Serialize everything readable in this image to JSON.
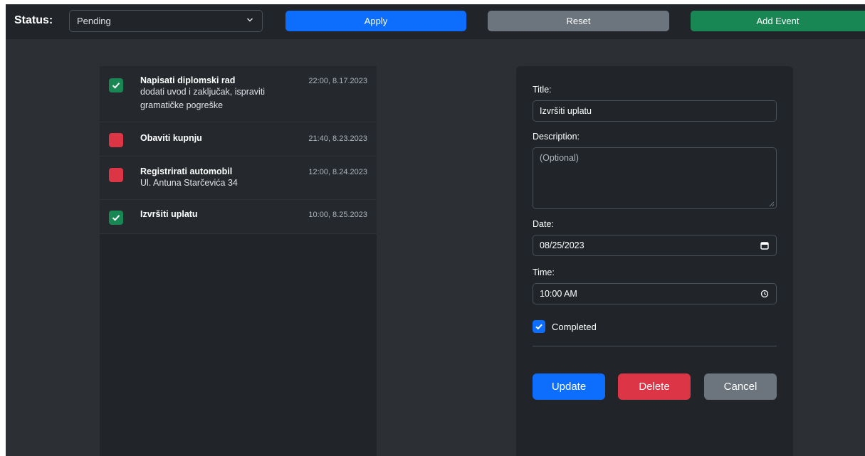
{
  "header": {
    "status_label": "Status:",
    "status_value": "Pending",
    "apply_label": "Apply",
    "reset_label": "Reset",
    "add_event_label": "Add Event"
  },
  "events": [
    {
      "title": "Napisati diplomski rad",
      "description": "dodati uvod i zaključak, ispraviti gramatičke pogreške",
      "time": "22:00, 8.17.2023",
      "completed": true
    },
    {
      "title": "Obaviti kupnju",
      "description": "",
      "time": "21:40, 8.23.2023",
      "completed": false
    },
    {
      "title": "Registrirati automobil",
      "description": "Ul. Antuna Starčevića 34",
      "time": "12:00, 8.24.2023",
      "completed": false
    },
    {
      "title": "Izvršiti uplatu",
      "description": "",
      "time": "10:00, 8.25.2023",
      "completed": true
    }
  ],
  "form": {
    "title_label": "Title:",
    "title_value": "Izvršiti uplatu",
    "description_label": "Description:",
    "description_placeholder": "(Optional)",
    "date_label": "Date:",
    "date_value": "08/25/2023",
    "time_label": "Time:",
    "time_value": "10:00 AM",
    "completed_label": "Completed",
    "completed": true,
    "update_label": "Update",
    "delete_label": "Delete",
    "cancel_label": "Cancel"
  },
  "colors": {
    "primary": "#0d6efd",
    "secondary": "#6c757d",
    "success": "#198754",
    "danger": "#dc3545",
    "background": "#2c3034",
    "panel": "#212529"
  },
  "icons": {
    "select_arrow": "chevron-down-icon",
    "date_picker": "calendar-icon",
    "time_picker": "clock-icon",
    "checked": "check-icon"
  }
}
